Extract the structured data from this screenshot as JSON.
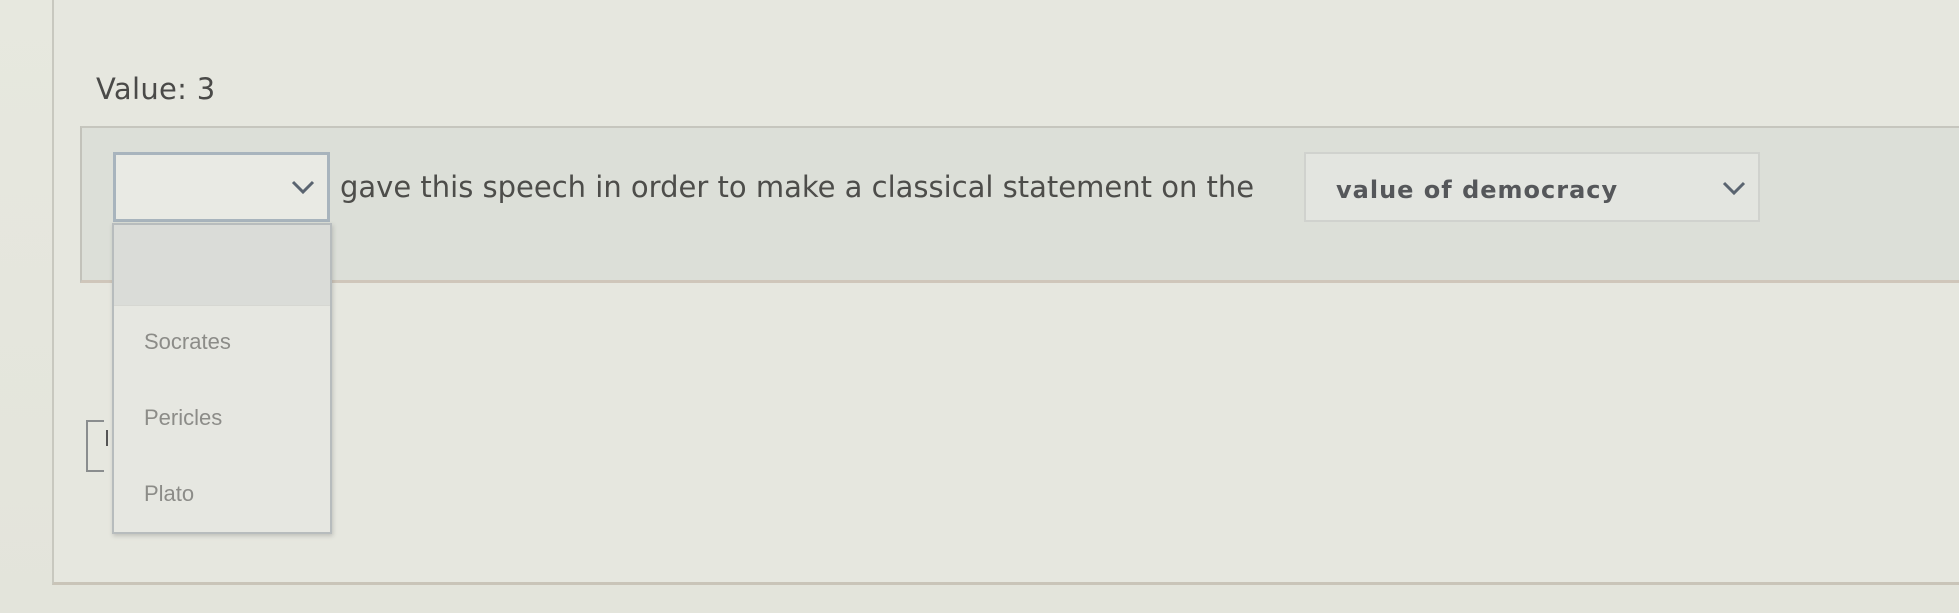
{
  "question": {
    "value_label": "Value: 3",
    "statement": "gave this speech in order to make a classical statement on the",
    "select_speaker": {
      "selected": "",
      "options": [
        "",
        "Socrates",
        "Pericles",
        "Plato"
      ]
    },
    "select_topic": {
      "selected": "value of democracy"
    }
  },
  "icons": {
    "dropdown_arrow": "chevron-down-icon"
  },
  "colors": {
    "background": "#e4e5dc",
    "focus_border": "#a8b4bd",
    "text": "#4d4d4a"
  }
}
